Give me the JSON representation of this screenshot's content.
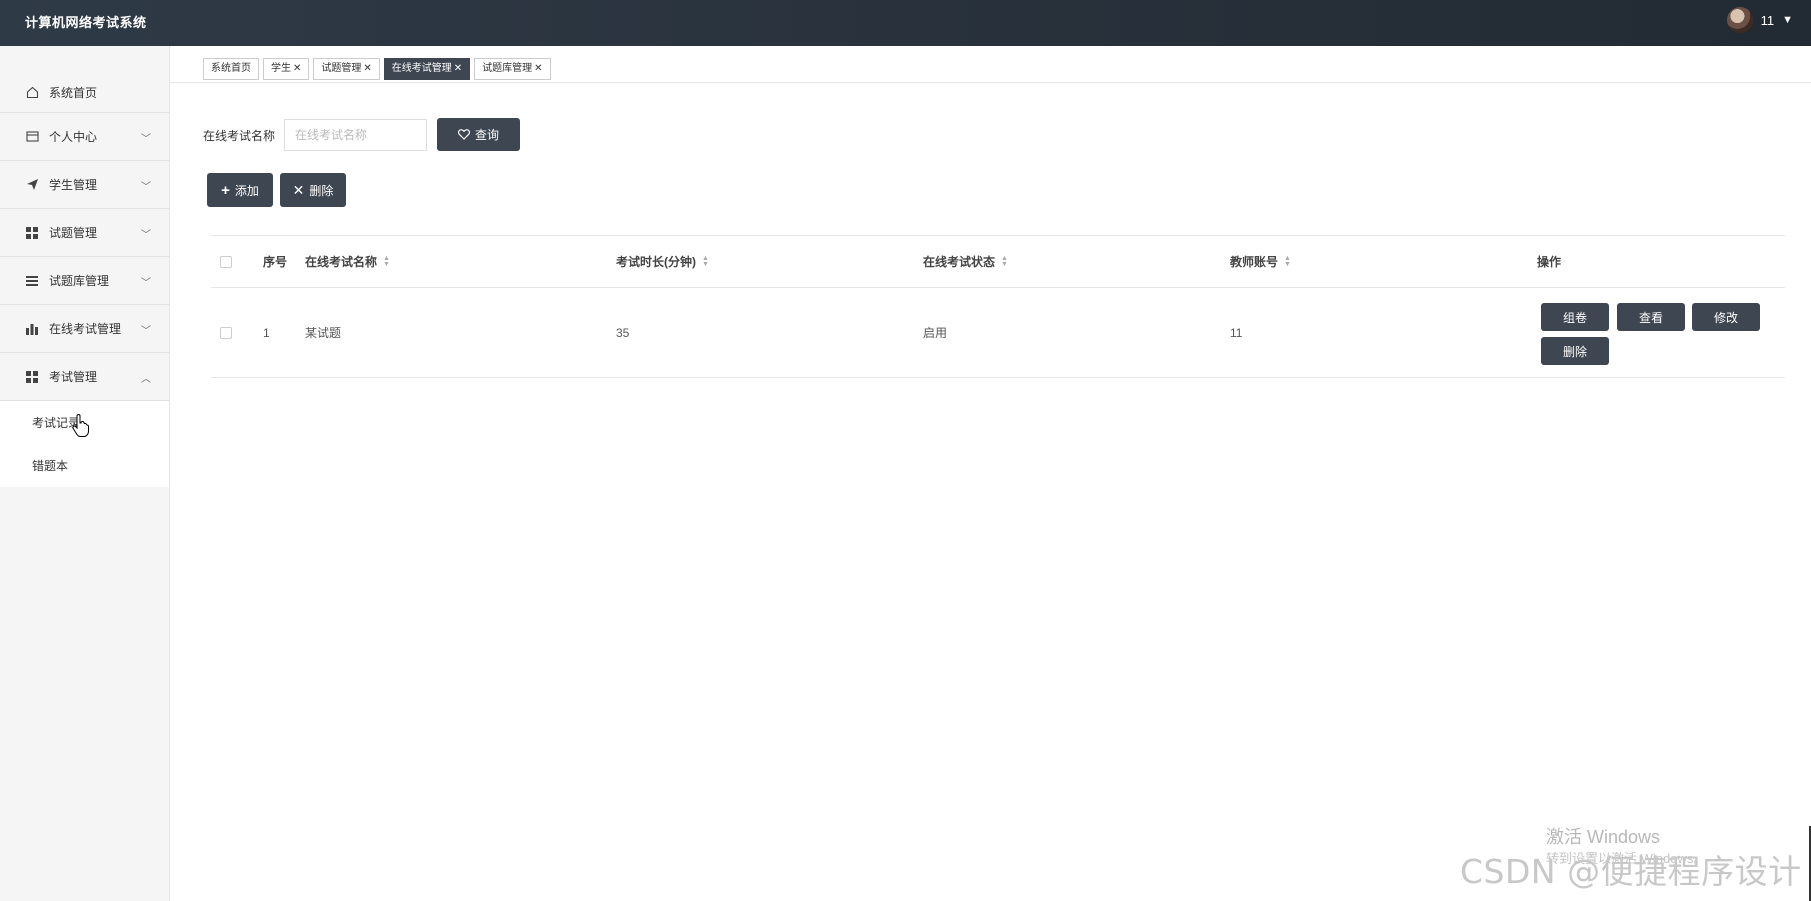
{
  "app": {
    "title": "计算机网络考试系统",
    "username": "11"
  },
  "sidebar": {
    "items": [
      {
        "label": "系统首页",
        "icon": "home-icon"
      },
      {
        "label": "个人中心",
        "icon": "card-icon"
      },
      {
        "label": "学生管理",
        "icon": "send-icon"
      },
      {
        "label": "试题管理",
        "icon": "grid-icon"
      },
      {
        "label": "试题库管理",
        "icon": "list-icon"
      },
      {
        "label": "在线考试管理",
        "icon": "bar-chart-icon"
      },
      {
        "label": "考试管理",
        "icon": "grid-icon"
      }
    ],
    "subitems": [
      {
        "label": "考试记录"
      },
      {
        "label": "错题本"
      }
    ]
  },
  "tabs": [
    {
      "label": "系统首页",
      "closable": false,
      "active": false
    },
    {
      "label": "学生",
      "closable": true,
      "active": false
    },
    {
      "label": "试题管理",
      "closable": true,
      "active": false
    },
    {
      "label": "在线考试管理",
      "closable": true,
      "active": true
    },
    {
      "label": "试题库管理",
      "closable": true,
      "active": false
    }
  ],
  "search": {
    "label": "在线考试名称",
    "placeholder": "在线考试名称",
    "query_button": "查询"
  },
  "actions": {
    "add": "添加",
    "delete": "删除"
  },
  "table": {
    "columns": [
      "序号",
      "在线考试名称",
      "考试时长(分钟)",
      "在线考试状态",
      "教师账号",
      "操作"
    ],
    "rows": [
      {
        "index": "1",
        "name": "某试题",
        "duration": "35",
        "status": "启用",
        "teacher": "11"
      }
    ],
    "row_actions": [
      "组卷",
      "查看",
      "修改",
      "删除"
    ]
  },
  "watermark": {
    "windows_line1": "激活 Windows",
    "windows_line2": "转到设置以激活 Windows。",
    "csdn": "CSDN @便捷程序设计"
  },
  "colors": {
    "topbar": "#29323c",
    "accent_dark": "#3d4651",
    "sidebar_bg": "#f5f5f5"
  }
}
